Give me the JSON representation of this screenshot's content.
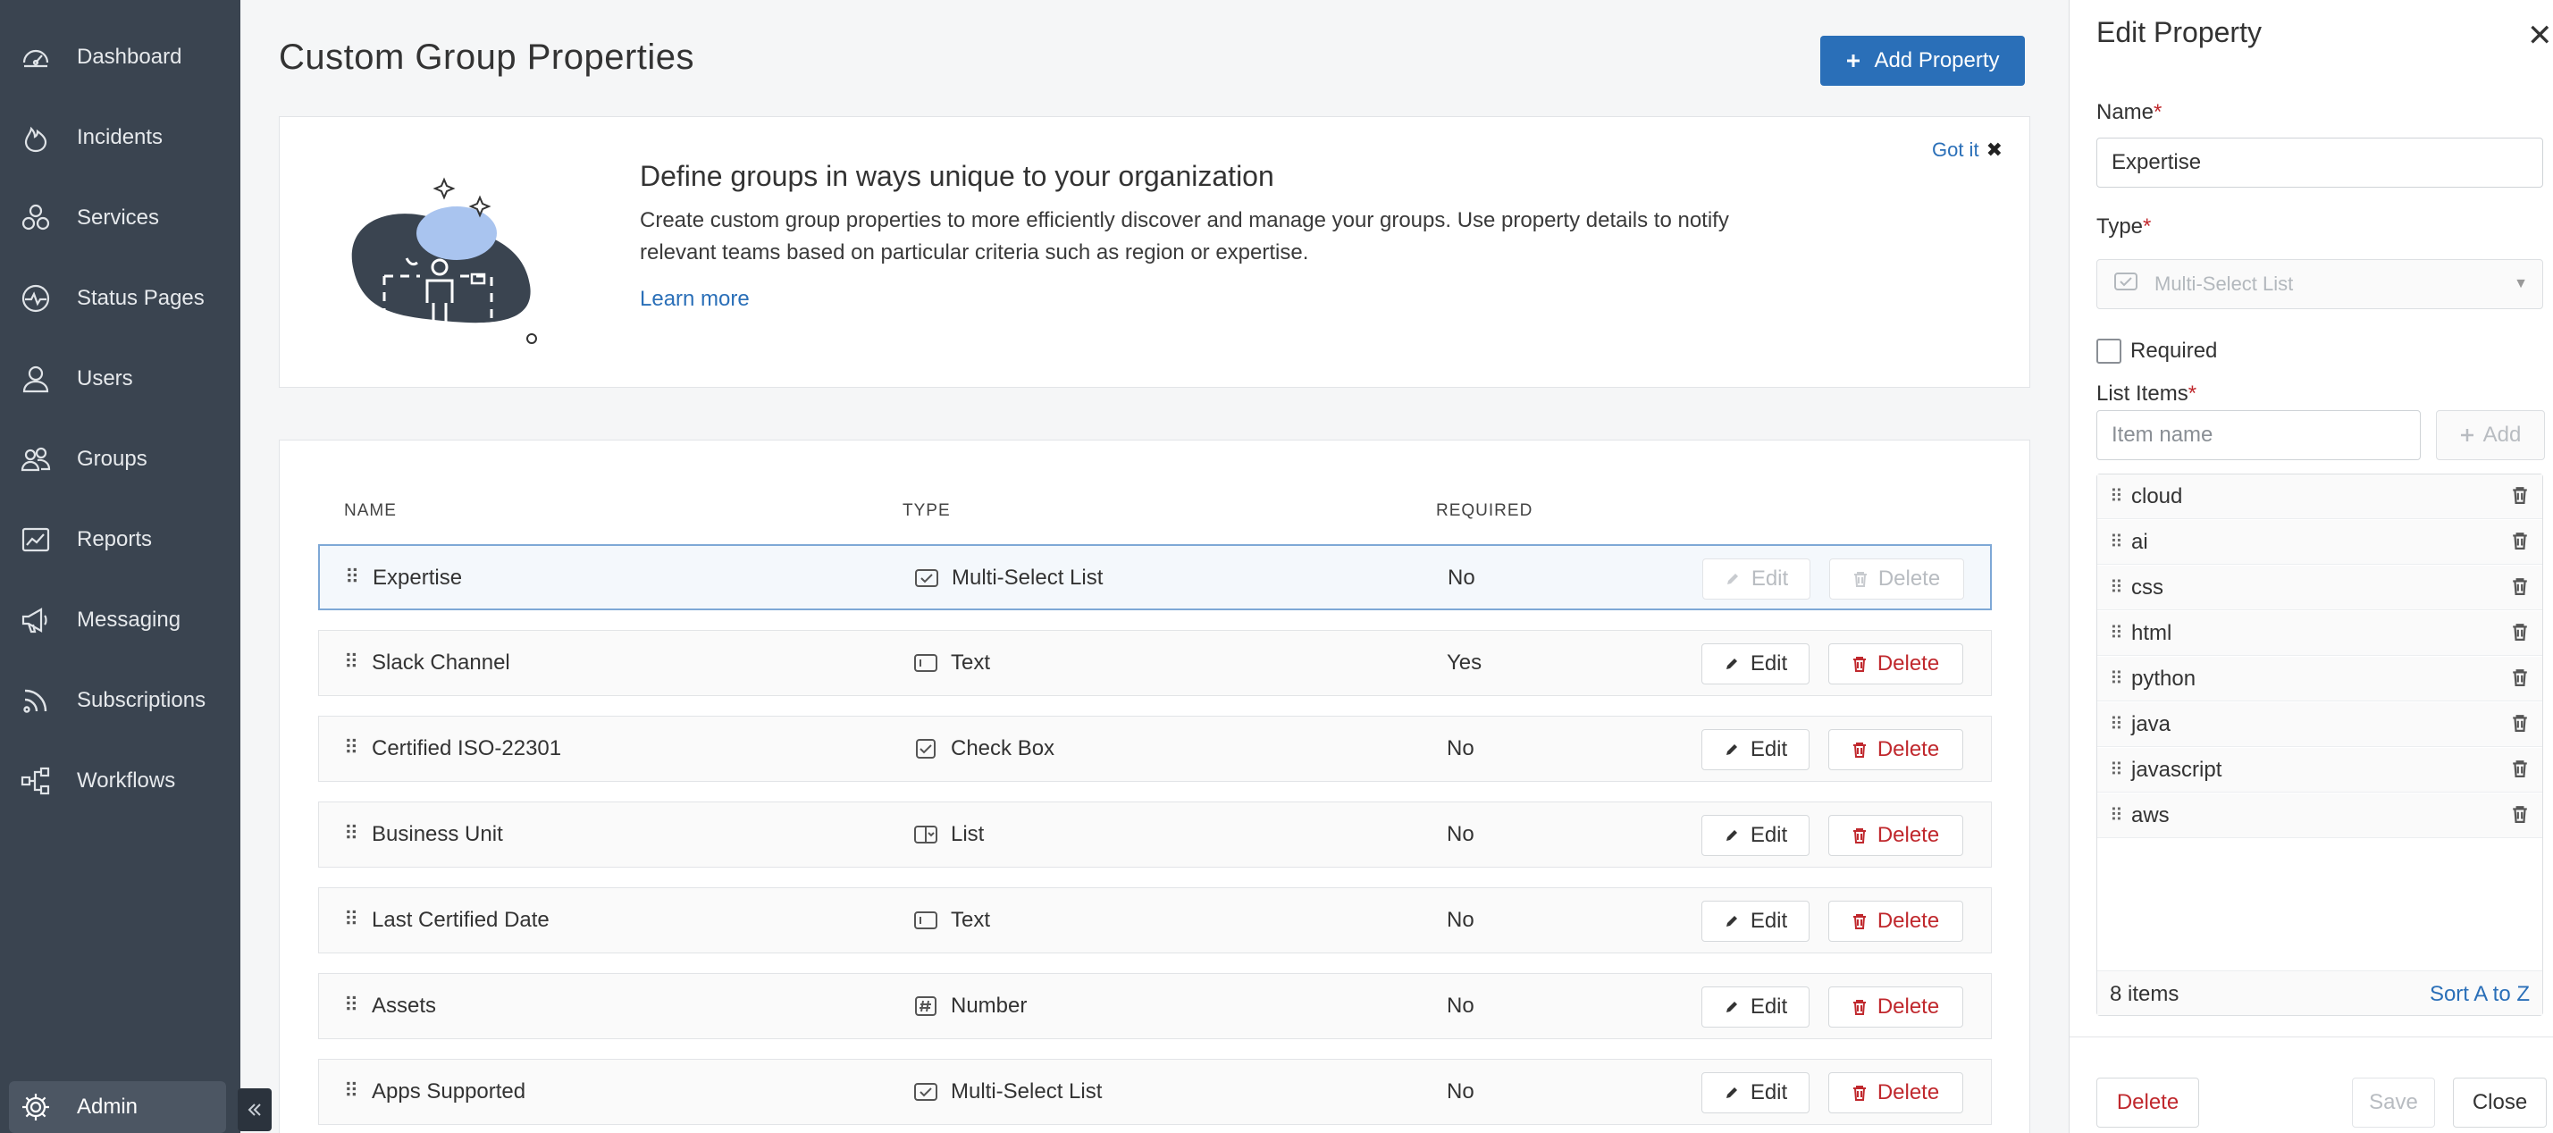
{
  "sidebar": {
    "items": [
      {
        "label": "Dashboard",
        "icon": "dashboard-icon"
      },
      {
        "label": "Incidents",
        "icon": "flame-icon"
      },
      {
        "label": "Services",
        "icon": "services-icon"
      },
      {
        "label": "Status Pages",
        "icon": "pulse-icon"
      },
      {
        "label": "Users",
        "icon": "user-icon"
      },
      {
        "label": "Groups",
        "icon": "groups-icon"
      },
      {
        "label": "Reports",
        "icon": "reports-icon"
      },
      {
        "label": "Messaging",
        "icon": "megaphone-icon"
      },
      {
        "label": "Subscriptions",
        "icon": "rss-icon"
      },
      {
        "label": "Workflows",
        "icon": "workflow-icon"
      }
    ],
    "admin_label": "Admin"
  },
  "header": {
    "title": "Custom Group Properties",
    "add_button": "Add Property"
  },
  "banner": {
    "title": "Define groups in ways unique to your organization",
    "text": "Create custom group properties to more efficiently discover and manage your groups. Use property details to notify relevant teams based on particular criteria such as region or expertise.",
    "link": "Learn more",
    "dismiss": "Got it"
  },
  "table": {
    "headers": {
      "name": "NAME",
      "type": "TYPE",
      "required": "REQUIRED"
    },
    "edit_label": "Edit",
    "delete_label": "Delete",
    "rows": [
      {
        "name": "Expertise",
        "type": "Multi-Select List",
        "type_icon": "multiselect-icon",
        "required": "No"
      },
      {
        "name": "Slack Channel",
        "type": "Text",
        "type_icon": "text-field-icon",
        "required": "Yes"
      },
      {
        "name": "Certified ISO-22301",
        "type": "Check Box",
        "type_icon": "checkbox-icon",
        "required": "No"
      },
      {
        "name": "Business Unit",
        "type": "List",
        "type_icon": "list-icon",
        "required": "No"
      },
      {
        "name": "Last Certified Date",
        "type": "Text",
        "type_icon": "text-field-icon",
        "required": "No"
      },
      {
        "name": "Assets",
        "type": "Number",
        "type_icon": "number-icon",
        "required": "No"
      },
      {
        "name": "Apps Supported",
        "type": "Multi-Select List",
        "type_icon": "multiselect-icon",
        "required": "No"
      }
    ]
  },
  "panel": {
    "title": "Edit Property",
    "name_label": "Name",
    "name_value": "Expertise",
    "type_label": "Type",
    "type_value": "Multi-Select List",
    "required_label": "Required",
    "list_items_label": "List Items",
    "item_placeholder": "Item name",
    "add_label": "Add",
    "items": [
      "cloud",
      "ai",
      "css",
      "html",
      "python",
      "java",
      "javascript",
      "aws"
    ],
    "count_text": "8 items",
    "sort_label": "Sort A to Z",
    "delete_label": "Delete",
    "save_label": "Save",
    "close_label": "Close"
  },
  "colors": {
    "sidebar": "#3a4450",
    "accent": "#2a6fb8",
    "danger": "#c0282d"
  }
}
